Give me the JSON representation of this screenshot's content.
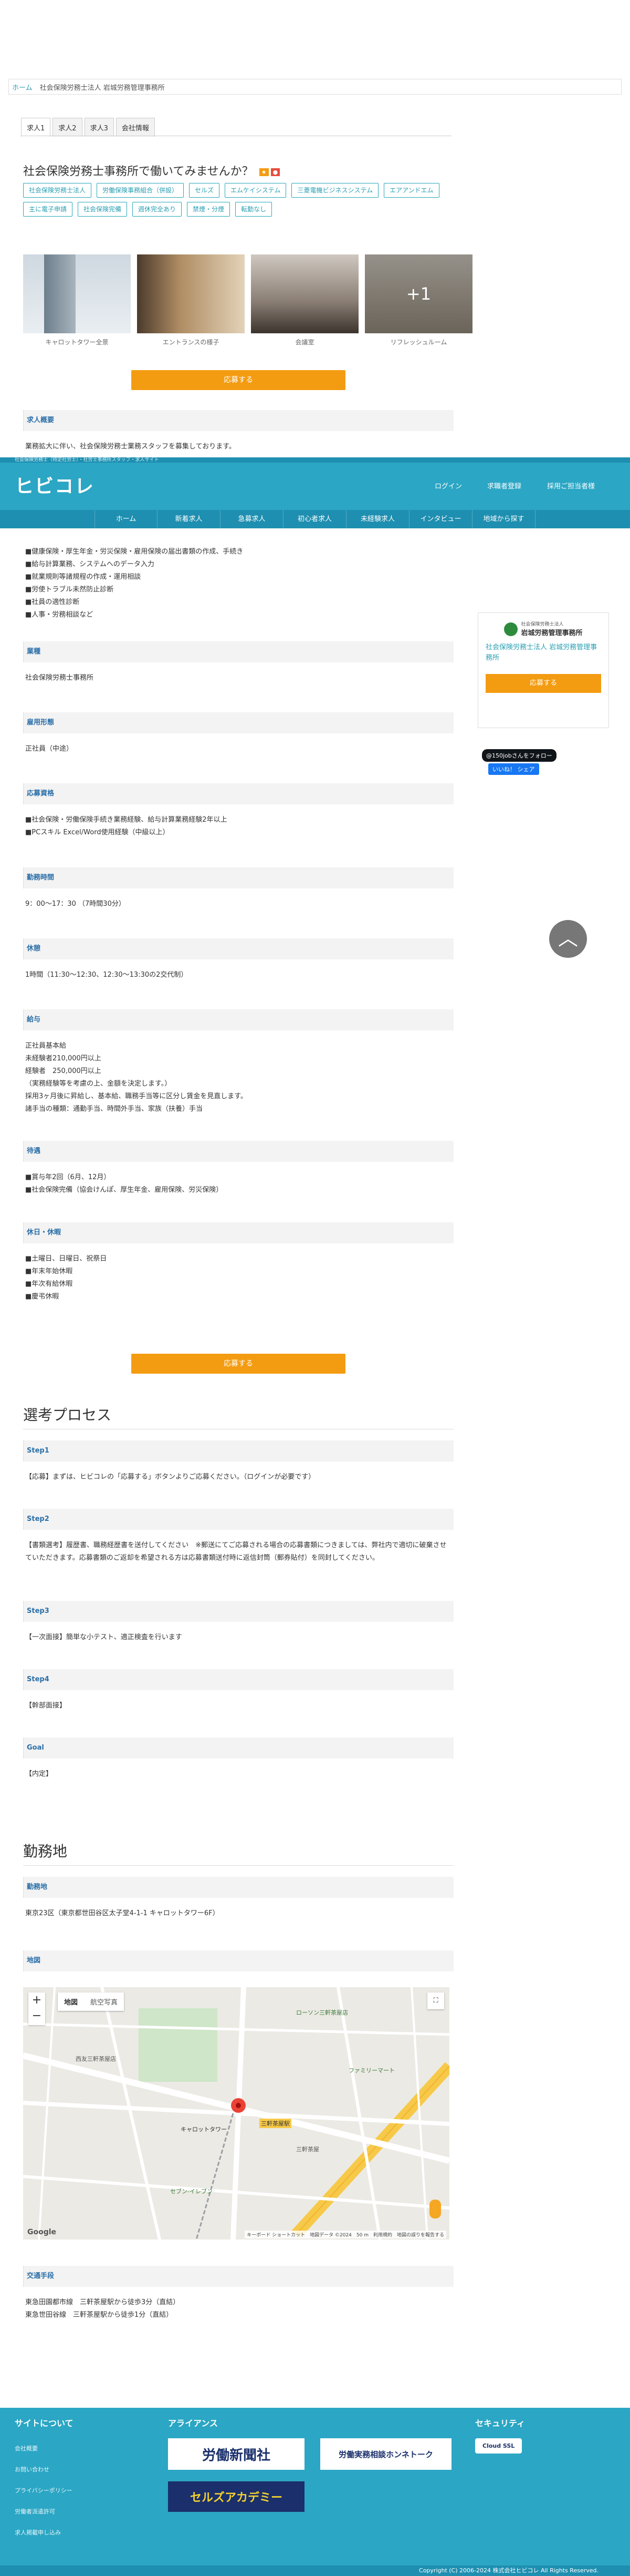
{
  "breadcrumb": {
    "home": "ホーム",
    "current": "社会保険労務士法人 岩城労務管理事務所"
  },
  "tabs": [
    "求人1",
    "求人2",
    "求人3",
    "会社情報"
  ],
  "page_title": "社会保険労務士事務所で働いてみませんか？",
  "tags": [
    "社会保険労務士法人",
    "労働保険事務組合（併設）",
    "セルズ",
    "エムケイシステム",
    "三菱電機ビジネスシステム",
    "エアアンドエム",
    "主に電子申請",
    "社会保険完備",
    "週休完全あり",
    "禁煙・分煙",
    "転勤なし"
  ],
  "photos": [
    {
      "caption": "キャロットタワー全景"
    },
    {
      "caption": "エントランスの様子"
    },
    {
      "caption": "会議室"
    },
    {
      "caption": "リフレッシュルーム",
      "more": "+1"
    }
  ],
  "apply_label": "応募する",
  "header": {
    "topbar": "社会保険労務士（特定社労士）・社労士事務所スタッフ・求人サイト",
    "logo": "ヒビコレ",
    "links": [
      "ログイン",
      "求職者登録",
      "採用ご担当者様"
    ]
  },
  "nav": [
    "ホーム",
    "新着求人",
    "急募求人",
    "初心者求人",
    "未経験求人",
    "インタビュー",
    "地域から探す"
  ],
  "sections": [
    {
      "title": "求人概要",
      "body": "業務拡大に伴い、社会保険労務士業務スタッフを募集しております。"
    },
    {
      "title": "",
      "body": "■健康保険・厚生年金・労災保険・雇用保険の届出書類の作成、手続き\n■給与計算業務、システムへのデータ入力\n■就業規則等諸規程の作成・運用相談\n■労使トラブル未然防止診断\n■社員の適性診断\n■人事・労務相談など"
    },
    {
      "title": "業種",
      "body": "社会保険労務士事務所"
    },
    {
      "title": "雇用形態",
      "body": "正社員（中途）"
    },
    {
      "title": "応募資格",
      "body": "■社会保険・労働保険手続き業務経験、給与計算業務経験2年以上\n■PCスキル Excel/Word使用経験（中級以上）"
    },
    {
      "title": "勤務時間",
      "body": "9：00〜17：30 （7時間30分）"
    },
    {
      "title": "休憩",
      "body": "1時間（11:30〜12:30、12:30〜13:30の2交代制）"
    },
    {
      "title": "給与",
      "body": "正社員基本給\n未経験者210,000円以上\n経験者　250,000円以上\n（実務経験等を考慮の上、金額を決定します。）\n採用3ヶ月後に昇給し、基本給、職務手当等に区分し賃金を見直します。\n諸手当の種類：通勤手当、時間外手当、家族（扶養）手当"
    },
    {
      "title": "待遇",
      "body": "■賞与年2回（6月、12月）\n■社会保険完備（協会けんぽ、厚生年金、雇用保険、労災保険）"
    },
    {
      "title": "休日・休暇",
      "body": "■土曜日、日曜日、祝祭日\n■年末年始休暇\n■年次有給休暇\n■慶弔休暇"
    }
  ],
  "sidebar": {
    "logo": "岩城労務管理事務所",
    "logo_sub": "社会保険労務士法人",
    "name": "社会保険労務士法人 岩城労務管理事務所",
    "apply": "応募する"
  },
  "social": {
    "x_follow": "@150jobさんをフォロー",
    "fb_like": "いいね！ シェア"
  },
  "process": {
    "title": "選考プロセス",
    "steps": [
      {
        "title": "Step1",
        "body": "【応募】まずは、ヒビコレの「応募する」ボタンよりご応募ください。（ログインが必要です）"
      },
      {
        "title": "Step2",
        "body": "【書類選考】履歴書、職務経歴書を送付してください　※郵送にてご応募される場合の応募書類につきましては、弊社内で適切に破棄させていただきます。応募書類のご返却を希望される方は応募書類送付時に返信封筒（郵券貼付）を同封してください。"
      },
      {
        "title": "Step3",
        "body": "【一次面接】簡単な小テスト、適正検査を行います"
      },
      {
        "title": "Step4",
        "body": "【幹部面接】"
      },
      {
        "title": "Goal",
        "body": "【内定】"
      }
    ]
  },
  "location": {
    "title": "勤務地",
    "place_title": "勤務地",
    "place": "東京23区（東京都世田谷区太子堂4-1-1 キャロットタワー6F）",
    "map_title": "地図",
    "map_tabs": [
      "地図",
      "航空写真"
    ],
    "map_labels": [
      "西友三軒茶屋店",
      "キャロットタワー",
      "三軒茶屋駅",
      "ローソン三軒茶屋店",
      "ファミリーマート",
      "三軒茶屋",
      "セブン-イレブン",
      "Google"
    ],
    "map_footer": "キーボード ショートカット　地図データ ©2024　50 m　利用規約　地図の誤りを報告する",
    "access_title": "交通手段",
    "access": "東急田園都市線　三軒茶屋駅から徒歩3分（直結）\n東急世田谷線　三軒茶屋駅から徒歩1分（直結）"
  },
  "footer": {
    "about_title": "サイトについて",
    "about_links": [
      "会社概要",
      "お問い合わせ",
      "プライバシーポリシー",
      "労働者派遣許可",
      "求人掲載申し込み"
    ],
    "alliance_title": "アライアンス",
    "banners": [
      "労働新聞社",
      "労働実務相談ホンネトーク",
      "セルズアカデミー"
    ],
    "security_title": "セキュリティ",
    "security_badge": "Cloud SSL",
    "copyright": "Copyright (C) 2006-2024 株式会社ヒビコレ All Rights Reserved."
  },
  "colors": {
    "brand": "#2ba6c4",
    "brand_dark": "#1e8fb0",
    "accent": "#f39c12",
    "link": "#2a9fb3"
  }
}
